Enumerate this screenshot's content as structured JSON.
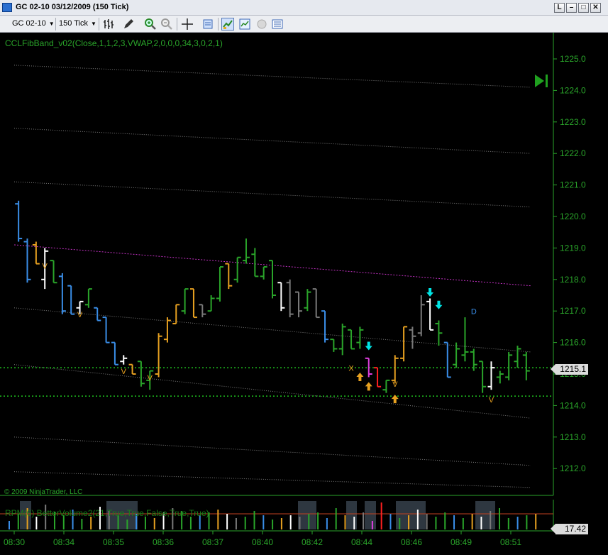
{
  "window": {
    "title": "GC 02-10  03/12/2009 (150 Tick)",
    "buttons": [
      "L",
      "–",
      "□",
      "✕"
    ]
  },
  "toolbar": {
    "instrument": "GC 02-10",
    "interval": "150 Tick",
    "icons": [
      "bar-type-icon",
      "drawing-pencil-icon",
      "zoom-in-icon",
      "zoom-out-icon",
      "crosshair-icon",
      "data-box-icon",
      "indicators-icon",
      "strategies-icon",
      "sphere-icon",
      "properties-icon"
    ]
  },
  "chart": {
    "indicator_label": "CCLFibBand_v02(Close,1,1,2,3,VWAP,2,0,0,0,34,3,0,2,1)",
    "copyright": "© 2009 NinjaTrader, LLC",
    "lower_panel_label": "RPM(6)   BetterVolume2(21,True,True,False,True,True)",
    "current_price": "1215.1",
    "current_volume": "17.42",
    "colors": {
      "background": "#000000",
      "axis": "#2aa52a",
      "vwap": "#c030c0",
      "band": "#7a7a7a",
      "up_bar": "#2aa52a",
      "down_bar": "#3a8ee8",
      "signal_cyan": "#00e5e5",
      "signal_orange": "#e6a020"
    }
  },
  "chart_data": {
    "type": "bar",
    "y_axis": {
      "ticks": [
        "1225.0",
        "1224.0",
        "1223.0",
        "1222.0",
        "1221.0",
        "1220.0",
        "1219.0",
        "1218.0",
        "1217.0",
        "1216.0",
        "1215.0",
        "1214.0",
        "1213.0",
        "1212.0"
      ],
      "ylim": [
        1211.5,
        1225.2
      ]
    },
    "x_axis": {
      "ticks": [
        "08:30",
        "08:34",
        "08:35",
        "08:36",
        "08:37",
        "08:40",
        "08:42",
        "08:44",
        "08:46",
        "08:49",
        "08:51"
      ]
    },
    "bars": [
      {
        "h": 1220.5,
        "l": 1219.2,
        "o": 1220.4,
        "c": 1219.3,
        "col": "#3a8ee8"
      },
      {
        "h": 1219.3,
        "l": 1217.9,
        "o": 1219.2,
        "c": 1218.0,
        "col": "#3a8ee8"
      },
      {
        "h": 1219.2,
        "l": 1218.5,
        "o": 1219.1,
        "c": 1218.5,
        "col": "#e6a020"
      },
      {
        "h": 1219.0,
        "l": 1217.7,
        "o": 1218.0,
        "c": 1218.9,
        "col": "#ffffff"
      },
      {
        "h": 1218.6,
        "l": 1217.9,
        "o": 1218.6,
        "c": 1217.9,
        "col": "#2aa52a"
      },
      {
        "h": 1218.2,
        "l": 1216.9,
        "o": 1218.1,
        "c": 1217.0,
        "col": "#3a8ee8"
      },
      {
        "h": 1217.8,
        "l": 1216.9,
        "o": 1217.8,
        "c": 1216.9,
        "col": "#3a8ee8"
      },
      {
        "h": 1217.3,
        "l": 1216.9,
        "o": 1217.1,
        "c": 1217.3,
        "col": "#ffffff"
      },
      {
        "h": 1217.7,
        "l": 1217.1,
        "o": 1217.2,
        "c": 1217.7,
        "col": "#2aa52a"
      },
      {
        "h": 1217.1,
        "l": 1216.7,
        "o": 1217.1,
        "c": 1216.7,
        "col": "#3a8ee8"
      },
      {
        "h": 1216.8,
        "l": 1216.0,
        "o": 1216.8,
        "c": 1216.0,
        "col": "#3a8ee8"
      },
      {
        "h": 1216.0,
        "l": 1215.3,
        "o": 1216.0,
        "c": 1215.3,
        "col": "#3a8ee8"
      },
      {
        "h": 1215.6,
        "l": 1215.3,
        "o": 1215.4,
        "c": 1215.5,
        "col": "#ffffff"
      },
      {
        "h": 1215.3,
        "l": 1215.0,
        "o": 1215.3,
        "c": 1215.0,
        "col": "#e6a020"
      },
      {
        "h": 1215.4,
        "l": 1214.6,
        "o": 1215.4,
        "c": 1214.7,
        "col": "#2aa52a"
      },
      {
        "h": 1215.1,
        "l": 1214.5,
        "o": 1214.8,
        "c": 1215.1,
        "col": "#2aa52a"
      },
      {
        "h": 1216.3,
        "l": 1214.9,
        "o": 1215.0,
        "c": 1216.2,
        "col": "#e6a020"
      },
      {
        "h": 1216.8,
        "l": 1216.0,
        "o": 1216.1,
        "c": 1216.7,
        "col": "#e6a020"
      },
      {
        "h": 1217.2,
        "l": 1216.6,
        "o": 1216.6,
        "c": 1217.2,
        "col": "#e6a020"
      },
      {
        "h": 1217.7,
        "l": 1216.9,
        "o": 1217.0,
        "c": 1217.7,
        "col": "#2aa52a"
      },
      {
        "h": 1217.7,
        "l": 1216.8,
        "o": 1217.7,
        "c": 1216.8,
        "col": "#e6a020"
      },
      {
        "h": 1217.2,
        "l": 1216.8,
        "o": 1217.2,
        "c": 1216.9,
        "col": "#7a7a7a"
      },
      {
        "h": 1217.5,
        "l": 1217.0,
        "o": 1217.0,
        "c": 1217.4,
        "col": "#2aa52a"
      },
      {
        "h": 1218.4,
        "l": 1217.3,
        "o": 1217.4,
        "c": 1218.4,
        "col": "#2aa52a"
      },
      {
        "h": 1218.5,
        "l": 1217.7,
        "o": 1218.5,
        "c": 1217.8,
        "col": "#e6a020"
      },
      {
        "h": 1218.7,
        "l": 1217.9,
        "o": 1218.0,
        "c": 1218.7,
        "col": "#2aa52a"
      },
      {
        "h": 1219.3,
        "l": 1218.5,
        "o": 1218.6,
        "c": 1218.7,
        "col": "#2aa52a"
      },
      {
        "h": 1219.0,
        "l": 1218.1,
        "o": 1218.8,
        "c": 1218.1,
        "col": "#2aa52a"
      },
      {
        "h": 1218.4,
        "l": 1218.0,
        "o": 1218.1,
        "c": 1218.4,
        "col": "#2aa52a"
      },
      {
        "h": 1218.6,
        "l": 1217.4,
        "o": 1218.6,
        "c": 1217.5,
        "col": "#2aa52a"
      },
      {
        "h": 1217.9,
        "l": 1217.0,
        "o": 1217.9,
        "c": 1217.1,
        "col": "#ffffff"
      },
      {
        "h": 1218.0,
        "l": 1216.8,
        "o": 1217.9,
        "c": 1216.9,
        "col": "#7a7a7a"
      },
      {
        "h": 1217.6,
        "l": 1216.8,
        "o": 1217.6,
        "c": 1217.0,
        "col": "#7a7a7a"
      },
      {
        "h": 1217.7,
        "l": 1217.0,
        "o": 1217.1,
        "c": 1217.6,
        "col": "#2aa52a"
      },
      {
        "h": 1217.7,
        "l": 1216.8,
        "o": 1217.7,
        "c": 1216.8,
        "col": "#7a7a7a"
      },
      {
        "h": 1217.0,
        "l": 1216.0,
        "o": 1217.0,
        "c": 1216.1,
        "col": "#3a8ee8"
      },
      {
        "h": 1216.1,
        "l": 1215.7,
        "o": 1216.1,
        "c": 1215.8,
        "col": "#2aa52a"
      },
      {
        "h": 1216.6,
        "l": 1215.6,
        "o": 1215.8,
        "c": 1216.5,
        "col": "#2aa52a"
      },
      {
        "h": 1216.4,
        "l": 1215.8,
        "o": 1216.4,
        "c": 1215.8,
        "col": "#2aa52a"
      },
      {
        "h": 1216.5,
        "l": 1215.8,
        "o": 1216.0,
        "c": 1216.4,
        "col": "#2aa52a"
      },
      {
        "h": 1215.5,
        "l": 1214.9,
        "o": 1215.5,
        "c": 1215.0,
        "col": "#e040e0"
      },
      {
        "h": 1215.2,
        "l": 1214.6,
        "o": 1215.2,
        "c": 1214.6,
        "col": "#ff2020"
      },
      {
        "h": 1214.8,
        "l": 1214.4,
        "o": 1214.5,
        "c": 1214.8,
        "col": "#2aa52a"
      },
      {
        "h": 1215.6,
        "l": 1214.7,
        "o": 1214.8,
        "c": 1215.5,
        "col": "#e6a020"
      },
      {
        "h": 1216.5,
        "l": 1215.4,
        "o": 1215.5,
        "c": 1216.5,
        "col": "#e6a020"
      },
      {
        "h": 1216.5,
        "l": 1215.8,
        "o": 1216.4,
        "c": 1216.2,
        "col": "#7a7a7a"
      },
      {
        "h": 1217.5,
        "l": 1216.2,
        "o": 1216.3,
        "c": 1217.2,
        "col": "#7a7a7a"
      },
      {
        "h": 1217.4,
        "l": 1216.4,
        "o": 1217.3,
        "c": 1216.4,
        "col": "#ffffff"
      },
      {
        "h": 1216.7,
        "l": 1215.9,
        "o": 1216.6,
        "c": 1216.3,
        "col": "#2aa52a"
      },
      {
        "h": 1216.0,
        "l": 1214.9,
        "o": 1216.0,
        "c": 1214.9,
        "col": "#3a8ee8"
      },
      {
        "h": 1216.0,
        "l": 1215.2,
        "o": 1215.3,
        "c": 1215.8,
        "col": "#2aa52a"
      },
      {
        "h": 1216.8,
        "l": 1215.4,
        "o": 1215.6,
        "c": 1215.7,
        "col": "#2aa52a"
      },
      {
        "h": 1215.8,
        "l": 1215.1,
        "o": 1215.7,
        "c": 1215.3,
        "col": "#2aa52a"
      },
      {
        "h": 1215.4,
        "l": 1214.4,
        "o": 1215.4,
        "c": 1214.6,
        "col": "#2aa52a"
      },
      {
        "h": 1215.4,
        "l": 1214.5,
        "o": 1214.6,
        "c": 1215.2,
        "col": "#ffffff"
      },
      {
        "h": 1215.1,
        "l": 1214.7,
        "o": 1214.9,
        "c": 1215.0,
        "col": "#2aa52a"
      },
      {
        "h": 1215.7,
        "l": 1214.8,
        "o": 1214.9,
        "c": 1215.6,
        "col": "#2aa52a"
      },
      {
        "h": 1215.9,
        "l": 1215.2,
        "o": 1215.4,
        "c": 1215.8,
        "col": "#2aa52a"
      },
      {
        "h": 1215.7,
        "l": 1214.8,
        "o": 1215.6,
        "c": 1215.1,
        "col": "#2aa52a"
      }
    ],
    "vwap": {
      "start": 1219.1,
      "end": 1217.8
    },
    "upper_bands": [
      {
        "start": 1224.8,
        "end": 1224.1
      },
      {
        "start": 1222.8,
        "end": 1222.0
      },
      {
        "start": 1221.1,
        "end": 1220.3
      },
      {
        "start": 1217.1,
        "end": 1215.7
      },
      {
        "start": 1215.3,
        "end": 1213.6
      },
      {
        "start": 1213.0,
        "end": 1212.1
      },
      {
        "start": 1211.9,
        "end": 1211.4
      }
    ],
    "hlines": [
      1215.2,
      1214.3
    ],
    "volume": {
      "ylim": [
        0,
        40
      ],
      "values": [
        12,
        22,
        30,
        18,
        35,
        25,
        20,
        28,
        15,
        18,
        32,
        26,
        20,
        14,
        22,
        18,
        16,
        24,
        30,
        26,
        18,
        20,
        24,
        28,
        22,
        16,
        18,
        26,
        20,
        14,
        16,
        20,
        18,
        22,
        24,
        16,
        30,
        20,
        18,
        24,
        12,
        38,
        22,
        16,
        20,
        28,
        22,
        18,
        24,
        20,
        16,
        22,
        18,
        26,
        30,
        16,
        18,
        20,
        22
      ],
      "shaded_ranges": [
        [
          28,
          44
        ],
        [
          150,
          194
        ],
        [
          420,
          446
        ],
        [
          488,
          503
        ],
        [
          514,
          530
        ],
        [
          558,
          600
        ],
        [
          670,
          698
        ]
      ]
    }
  }
}
